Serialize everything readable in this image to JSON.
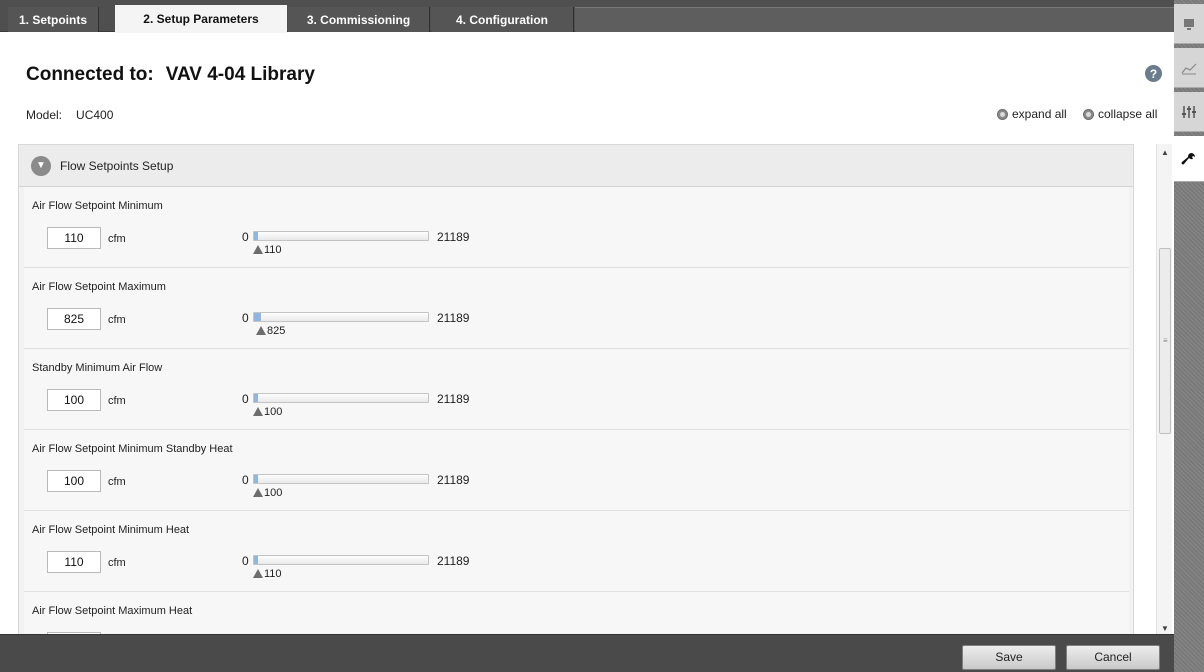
{
  "tabs": [
    {
      "label": "1. Setpoints"
    },
    {
      "label": "2. Setup Parameters"
    },
    {
      "label": "3. Commissioning"
    },
    {
      "label": "4. Configuration"
    }
  ],
  "header": {
    "connected_label": "Connected to:",
    "device_name": "VAV 4-04 Library",
    "model_label": "Model:",
    "model_value": "UC400",
    "expand_all": "expand all",
    "collapse_all": "collapse all"
  },
  "section": {
    "title": "Flow Setpoints Setup",
    "rows": [
      {
        "label": "Air Flow Setpoint Minimum",
        "value": "110",
        "unit": "cfm",
        "min": "0",
        "max": "21189",
        "marker": "110",
        "fraction": 0.0052
      },
      {
        "label": "Air Flow Setpoint Maximum",
        "value": "825",
        "unit": "cfm",
        "min": "0",
        "max": "21189",
        "marker": "825",
        "fraction": 0.039
      },
      {
        "label": "Standby Minimum Air Flow",
        "value": "100",
        "unit": "cfm",
        "min": "0",
        "max": "21189",
        "marker": "100",
        "fraction": 0.0047
      },
      {
        "label": "Air Flow Setpoint Minimum Standby Heat",
        "value": "100",
        "unit": "cfm",
        "min": "0",
        "max": "21189",
        "marker": "100",
        "fraction": 0.0047
      },
      {
        "label": "Air Flow Setpoint Minimum Heat",
        "value": "110",
        "unit": "cfm",
        "min": "0",
        "max": "21189",
        "marker": "110",
        "fraction": 0.0052
      },
      {
        "label": "Air Flow Setpoint Maximum Heat",
        "value": "",
        "unit": "",
        "min": "",
        "max": "",
        "marker": "",
        "fraction": 0
      }
    ]
  },
  "footer": {
    "save_label": "Save",
    "cancel_label": "Cancel"
  },
  "rail": [
    "monitor-icon",
    "chart-icon",
    "sliders-icon",
    "wrench-icon"
  ],
  "colors": {
    "slider_fill": "#8fb6dc",
    "tab_bar": "#4f4f4f",
    "footer": "#4a4a4a"
  }
}
